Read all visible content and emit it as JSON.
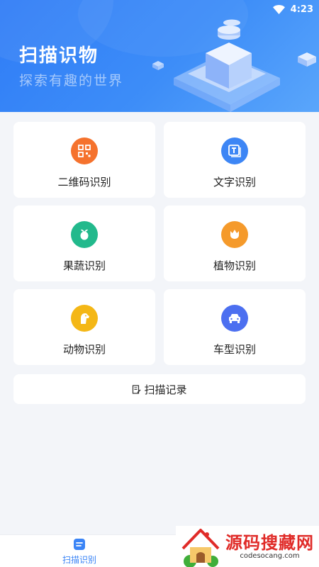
{
  "status": {
    "time": "4:23",
    "wifi_icon": "wifi-icon"
  },
  "hero": {
    "title": "扫描识物",
    "subtitle": "探索有趣的世界"
  },
  "cards": [
    {
      "label": "二维码识别",
      "icon": "qrcode-icon",
      "color": "#f5722d"
    },
    {
      "label": "文字识别",
      "icon": "text-icon",
      "color": "#3d86f5"
    },
    {
      "label": "果蔬识别",
      "icon": "vegetable-icon",
      "color": "#22b98c"
    },
    {
      "label": "植物识别",
      "icon": "flower-icon",
      "color": "#f59a2b"
    },
    {
      "label": "动物识别",
      "icon": "dog-icon",
      "color": "#f4b716"
    },
    {
      "label": "车型识别",
      "icon": "car-icon",
      "color": "#4c6ff0"
    }
  ],
  "record": {
    "label": "扫描记录",
    "icon": "record-icon"
  },
  "tabbar": {
    "tab_label": "扫描识别",
    "tab_icon": "scan-tab-icon",
    "accent": "#3a84f6"
  },
  "watermark": {
    "main": "源码搜藏网",
    "sub": "codesocang.com"
  }
}
